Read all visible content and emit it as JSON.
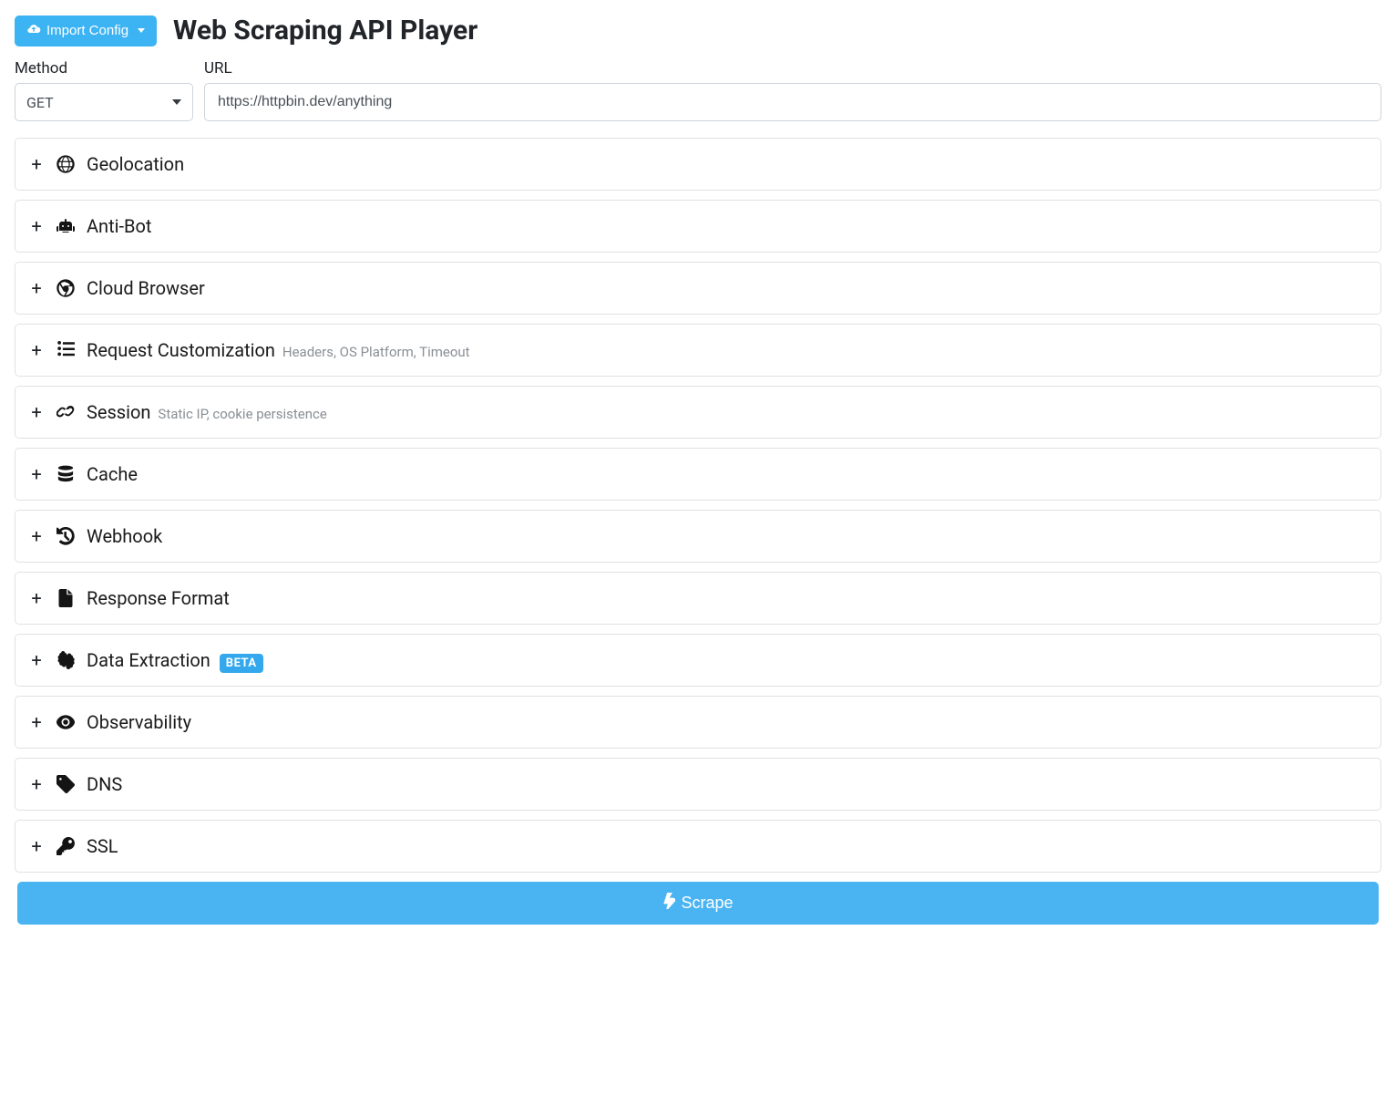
{
  "header": {
    "import_label": "Import Config",
    "title": "Web Scraping API Player"
  },
  "form": {
    "method_label": "Method",
    "method_value": "GET",
    "url_label": "URL",
    "url_value": "https://httpbin.dev/anything"
  },
  "panels": [
    {
      "key": "geolocation",
      "title": "Geolocation",
      "sub": "",
      "icon": "globe-icon",
      "badge": ""
    },
    {
      "key": "anti-bot",
      "title": "Anti-Bot",
      "sub": "",
      "icon": "robot-icon",
      "badge": ""
    },
    {
      "key": "cloud-browser",
      "title": "Cloud Browser",
      "sub": "",
      "icon": "chrome-icon",
      "badge": ""
    },
    {
      "key": "request-customization",
      "title": "Request Customization",
      "sub": "Headers, OS Platform, Timeout",
      "icon": "list-icon",
      "badge": ""
    },
    {
      "key": "session",
      "title": "Session",
      "sub": "Static IP, cookie persistence",
      "icon": "link-icon",
      "badge": ""
    },
    {
      "key": "cache",
      "title": "Cache",
      "sub": "",
      "icon": "database-icon",
      "badge": ""
    },
    {
      "key": "webhook",
      "title": "Webhook",
      "sub": "",
      "icon": "history-icon",
      "badge": ""
    },
    {
      "key": "response-format",
      "title": "Response Format",
      "sub": "",
      "icon": "file-icon",
      "badge": ""
    },
    {
      "key": "data-extraction",
      "title": "Data Extraction",
      "sub": "",
      "icon": "brain-icon",
      "badge": "BETA"
    },
    {
      "key": "observability",
      "title": "Observability",
      "sub": "",
      "icon": "eye-icon",
      "badge": ""
    },
    {
      "key": "dns",
      "title": "DNS",
      "sub": "",
      "icon": "tag-icon",
      "badge": ""
    },
    {
      "key": "ssl",
      "title": "SSL",
      "sub": "",
      "icon": "key-icon",
      "badge": ""
    }
  ],
  "action": {
    "scrape_label": "Scrape"
  }
}
